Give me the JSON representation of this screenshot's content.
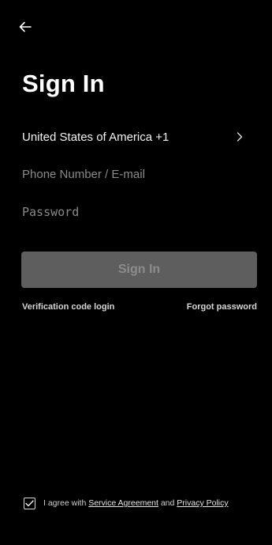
{
  "header": {
    "back_icon": "arrow-left-icon"
  },
  "page": {
    "title": "Sign In"
  },
  "country": {
    "label": "United States of America +1",
    "chevron_icon": "chevron-right-icon"
  },
  "fields": {
    "phone_placeholder": "Phone Number / E-mail",
    "password_placeholder": "Password"
  },
  "actions": {
    "sign_in_label": "Sign In",
    "verification_login_label": "Verification code login",
    "forgot_password_label": "Forgot password"
  },
  "agreement": {
    "checked": true,
    "prefix": "I agree with ",
    "service_link": "Service Agreement",
    "conjunction": " and ",
    "privacy_link": "Privacy Policy",
    "check_icon": "checkmark-icon"
  },
  "colors": {
    "background": "#000000",
    "button_disabled_bg": "#5e5e5e",
    "button_disabled_text": "#8c8c8c",
    "placeholder": "#8a8a8a"
  }
}
